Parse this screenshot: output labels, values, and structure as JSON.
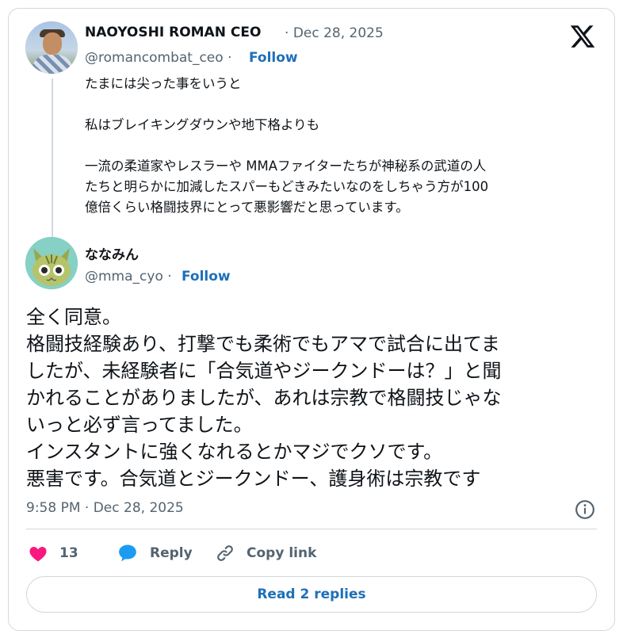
{
  "parent_tweet": {
    "author_name": "NAOYOSHI ROMAN CEO",
    "separator": "·",
    "date": "Dec 28, 2025",
    "handle": "@romancombat_ceo",
    "follow_label": "Follow",
    "text": "たまには尖った事をいうと\n\n私はブレイキングダウンや地下格よりも\n\n一流の柔道家やレスラーや MMAファイターたちが神秘系の武道の人\nたちと明らかに加減したスパーもどきみたいなのをしちゃう方が100\n億倍くらい格闘技界にとって悪影響だと思っています。"
  },
  "main_tweet": {
    "author_name": "ななみん",
    "handle": "@mma_cyo",
    "follow_label": "Follow",
    "text": "全く同意。\n格闘技経験あり、打撃でも柔術でもアマで試合に出てま\nしたが、未経験者に「合気道やジークンドーは？」と聞\nかれることがありましたが、あれは宗教で格闘技じゃな\nいっと必ず言ってました。\nインスタントに強くなれるとかマジでクソです。\n悪害です。合気道とジークンドー、護身術は宗教です",
    "timestamp": "9:58 PM · Dec 28, 2025"
  },
  "actions": {
    "like_count": "13",
    "reply_label": "Reply",
    "copy_link_label": "Copy link"
  },
  "read_replies_label": "Read 2 replies",
  "colors": {
    "link": "#1d70b8",
    "like": "#f91880",
    "reply": "#1d9bf0",
    "muted": "#536471",
    "border": "#cfd9de"
  }
}
